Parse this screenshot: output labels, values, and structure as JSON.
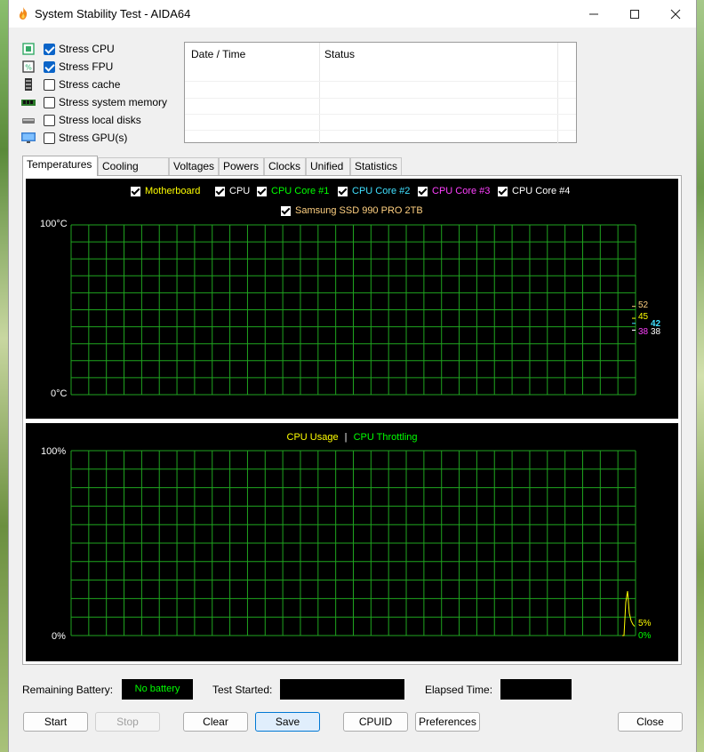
{
  "window": {
    "title": "System Stability Test - AIDA64"
  },
  "stress": [
    {
      "label": "Stress CPU",
      "checked": true,
      "icon": "cpu-chip-icon"
    },
    {
      "label": "Stress FPU",
      "checked": true,
      "icon": "fpu-chip-icon"
    },
    {
      "label": "Stress cache",
      "checked": false,
      "icon": "cache-icon"
    },
    {
      "label": "Stress system memory",
      "checked": false,
      "icon": "memory-module-icon"
    },
    {
      "label": "Stress local disks",
      "checked": false,
      "icon": "disk-drive-icon"
    },
    {
      "label": "Stress GPU(s)",
      "checked": false,
      "icon": "monitor-icon"
    }
  ],
  "log": {
    "columns": [
      "Date / Time",
      "Status"
    ],
    "rows": []
  },
  "tabs": [
    "Temperatures",
    "Cooling Fans",
    "Voltages",
    "Powers",
    "Clocks",
    "Unified",
    "Statistics"
  ],
  "active_tab": "Temperatures",
  "temp_graph": {
    "legend": [
      {
        "label": "Motherboard",
        "color": "#ffff00"
      },
      {
        "label": "CPU",
        "color": "#ffffff"
      },
      {
        "label": "CPU Core #1",
        "color": "#00ff00"
      },
      {
        "label": "CPU Core #2",
        "color": "#40e0ff"
      },
      {
        "label": "CPU Core #3",
        "color": "#ff40ff"
      },
      {
        "label": "CPU Core #4",
        "color": "#ffffff"
      },
      {
        "label": "Samsung SSD 990 PRO 2TB",
        "color": "#ffd080"
      }
    ],
    "y_max_label": "100°C",
    "y_min_label": "0°C",
    "readings": [
      {
        "value": "52",
        "color": "#ffd080",
        "level": 52
      },
      {
        "value": "45",
        "color": "#ffff00",
        "level": 45
      },
      {
        "value": "42",
        "color": "#40e0ff",
        "level": 42
      },
      {
        "value": "38",
        "color": "#ff40ff",
        "level": 38
      },
      {
        "value": "38",
        "color": "#ffffff",
        "level": 38
      }
    ]
  },
  "usage_graph": {
    "title_left": "CPU Usage",
    "title_sep": "|",
    "title_right": "CPU Throttling",
    "title_left_color": "#ffff00",
    "title_right_color": "#00ff00",
    "y_max_label": "100%",
    "y_min_label": "0%",
    "readings": [
      {
        "value": "5%",
        "color": "#ffff00",
        "level": 5
      },
      {
        "value": "0%",
        "color": "#00ff00",
        "level": 0
      }
    ],
    "recent_usage": [
      0,
      0,
      18,
      24,
      12,
      8,
      6,
      5
    ]
  },
  "status": {
    "battery_label": "Remaining Battery:",
    "battery_value": "No battery",
    "test_started_label": "Test Started:",
    "test_started_value": "",
    "elapsed_label": "Elapsed Time:",
    "elapsed_value": ""
  },
  "buttons": {
    "start": "Start",
    "stop": "Stop",
    "clear": "Clear",
    "save": "Save",
    "cpuid": "CPUID",
    "preferences": "Preferences",
    "close": "Close"
  }
}
